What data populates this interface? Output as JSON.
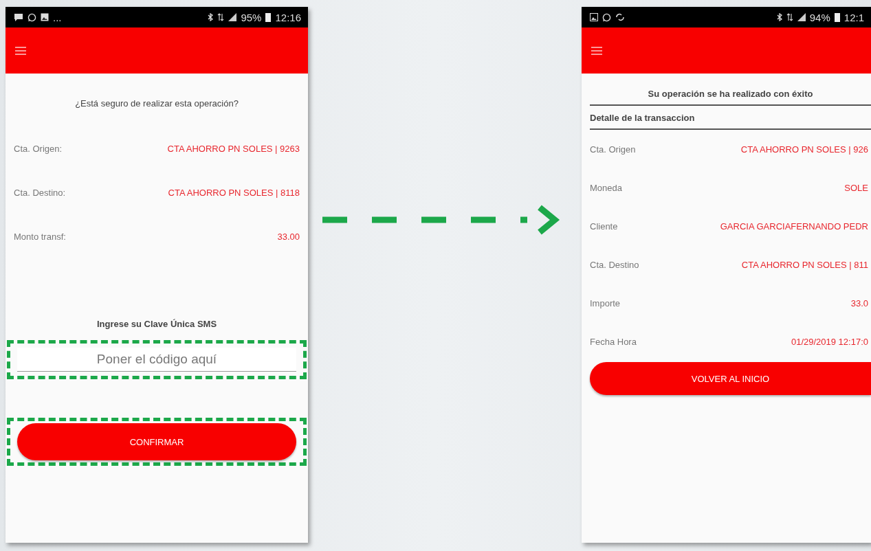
{
  "screens": [
    {
      "kind": "confirm",
      "status_bar": {
        "overflow": "...",
        "battery": "95%",
        "time": "12:16"
      },
      "question": "¿Está seguro de realizar esta operación?",
      "rows": [
        {
          "label": "Cta. Origen:",
          "value": "CTA AHORRO PN SOLES | 9263"
        },
        {
          "label": "Cta. Destino:",
          "value": "CTA AHORRO PN SOLES | 8118"
        },
        {
          "label": "Monto transf:",
          "value": "33.00"
        }
      ],
      "sms_prompt": "Ingrese su Clave Única SMS",
      "code_field": {
        "placeholder": "Poner el código aquí"
      },
      "button": "CONFIRMAR"
    },
    {
      "kind": "receipt",
      "status_bar": {
        "battery": "94%",
        "time": "12:1"
      },
      "title": "Su operación se ha realizado con éxito",
      "section": "Detalle de la transaccion",
      "rows": [
        {
          "label": "Cta. Origen",
          "value": "CTA AHORRO PN SOLES | 926"
        },
        {
          "label": "Moneda",
          "value": "SOLE"
        },
        {
          "label": "Cliente",
          "value": "GARCIA GARCIAFERNANDO PEDR"
        },
        {
          "label": "Cta. Destino",
          "value": "CTA AHORRO PN SOLES | 811"
        },
        {
          "label": "Importe",
          "value": "33.0"
        },
        {
          "label": "Fecha Hora",
          "value": "01/29/2019 12:17:0"
        }
      ],
      "button": "VOLVER AL INICIO"
    }
  ]
}
